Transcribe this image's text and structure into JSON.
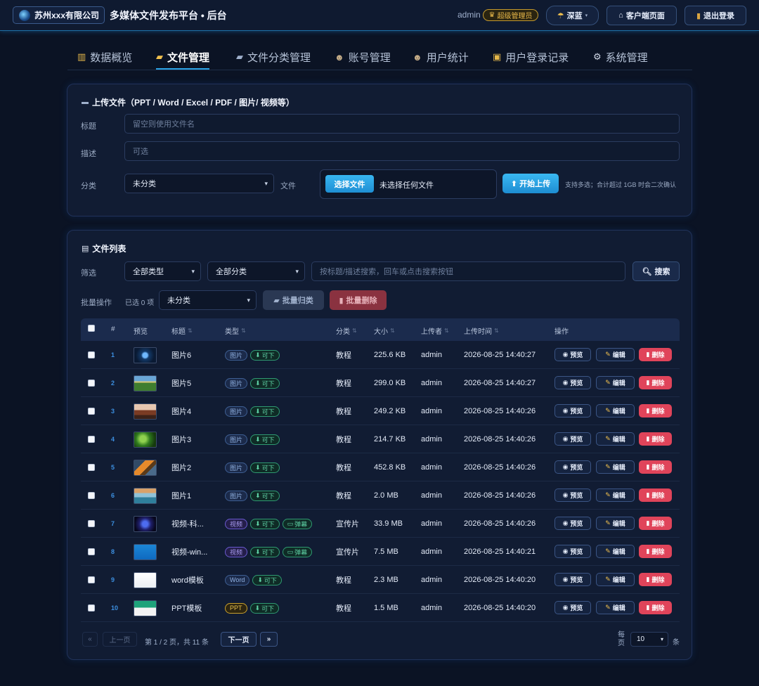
{
  "header": {
    "company": "苏州xxx有限公司",
    "title": "多媒体文件发布平台 • 后台",
    "user": "admin",
    "role": "超级管理员",
    "theme_label": "深蓝",
    "client_label": "客户端页面",
    "logout_label": "退出登录"
  },
  "tabs": [
    {
      "label": "数据概览",
      "icon": "chart-icon"
    },
    {
      "label": "文件管理",
      "icon": "folder-icon"
    },
    {
      "label": "文件分类管理",
      "icon": "category-icon"
    },
    {
      "label": "账号管理",
      "icon": "account-icon"
    },
    {
      "label": "用户统计",
      "icon": "users-icon"
    },
    {
      "label": "用户登录记录",
      "icon": "lock-icon"
    },
    {
      "label": "系统管理",
      "icon": "gear-icon"
    }
  ],
  "active_tab": "文件管理",
  "upload": {
    "title": "上传文件（PPT / Word / Excel / PDF / 图片/ 视频等）",
    "title_label": "标题",
    "title_placeholder": "留空则使用文件名",
    "desc_label": "描述",
    "desc_placeholder": "可选",
    "category_label": "分类",
    "category_value": "未分类",
    "file_label": "文件",
    "choose_label": "选择文件",
    "no_file_text": "未选择任何文件",
    "start_label": "开始上传",
    "hint": "支持多选；合计超过 1GB 时会二次确认"
  },
  "list": {
    "title": "文件列表",
    "filter_label": "筛选",
    "type_filter": "全部类型",
    "category_filter": "全部分类",
    "search_placeholder": "按标题/描述搜索，回车或点击搜索按钮",
    "search_label": "搜索",
    "batch_label": "批量操作",
    "selected_text": "已选 0 项",
    "batch_category": "未分类",
    "batch_assign_label": "批量归类",
    "batch_delete_label": "批量删除",
    "columns": [
      "#",
      "预览",
      "标题",
      "类型",
      "分类",
      "大小",
      "上传者",
      "上传时间",
      "操作"
    ],
    "rows": [
      {
        "num": "1",
        "title": "图片6",
        "type": "图片",
        "download": "可下",
        "danmu": "",
        "category": "教程",
        "size": "225.6 KB",
        "uploader": "admin",
        "time": "2026-08-25 14:40:27",
        "thumb": "eye"
      },
      {
        "num": "2",
        "title": "图片5",
        "type": "图片",
        "download": "可下",
        "danmu": "",
        "category": "教程",
        "size": "299.0 KB",
        "uploader": "admin",
        "time": "2026-08-25 14:40:27",
        "thumb": "meadow"
      },
      {
        "num": "3",
        "title": "图片4",
        "type": "图片",
        "download": "可下",
        "danmu": "",
        "category": "教程",
        "size": "249.2 KB",
        "uploader": "admin",
        "time": "2026-08-25 14:40:26",
        "thumb": "desert"
      },
      {
        "num": "4",
        "title": "图片3",
        "type": "图片",
        "download": "可下",
        "danmu": "",
        "category": "教程",
        "size": "214.7 KB",
        "uploader": "admin",
        "time": "2026-08-25 14:40:26",
        "thumb": "leaf"
      },
      {
        "num": "5",
        "title": "图片2",
        "type": "图片",
        "download": "可下",
        "danmu": "",
        "category": "教程",
        "size": "452.8 KB",
        "uploader": "admin",
        "time": "2026-08-25 14:40:26",
        "thumb": "butterfly"
      },
      {
        "num": "6",
        "title": "图片1",
        "type": "图片",
        "download": "可下",
        "danmu": "",
        "category": "教程",
        "size": "2.0 MB",
        "uploader": "admin",
        "time": "2026-08-25 14:40:26",
        "thumb": "beach"
      },
      {
        "num": "7",
        "title": "视频-科...",
        "type": "视频",
        "download": "可下",
        "danmu": "弹幕",
        "category": "宣传片",
        "size": "33.9 MB",
        "uploader": "admin",
        "time": "2026-08-25 14:40:26",
        "thumb": "space"
      },
      {
        "num": "8",
        "title": "视频-win...",
        "type": "视频",
        "download": "可下",
        "danmu": "弹幕",
        "category": "宣传片",
        "size": "7.5 MB",
        "uploader": "admin",
        "time": "2026-08-25 14:40:21",
        "thumb": "windows"
      },
      {
        "num": "9",
        "title": "word模板",
        "type": "Word",
        "download": "可下",
        "danmu": "",
        "category": "教程",
        "size": "2.3 MB",
        "uploader": "admin",
        "time": "2026-08-25 14:40:20",
        "thumb": "doc"
      },
      {
        "num": "10",
        "title": "PPT模板",
        "type": "PPT",
        "download": "可下",
        "danmu": "",
        "category": "教程",
        "size": "1.5 MB",
        "uploader": "admin",
        "time": "2026-08-25 14:40:20",
        "thumb": "ppt"
      }
    ],
    "action_preview": "预览",
    "action_edit": "编辑",
    "action_delete": "删除"
  },
  "pagination": {
    "first": "«",
    "prev": "上一页",
    "info": "第 1 / 2 页，共 11 条",
    "next": "下一页",
    "last": "»",
    "per_page_label": "每页",
    "per_page_value": "10",
    "per_page_unit": "条"
  },
  "colors": {
    "accent": "#2ba4e6",
    "danger": "#e0445a",
    "background": "#0b1324"
  }
}
